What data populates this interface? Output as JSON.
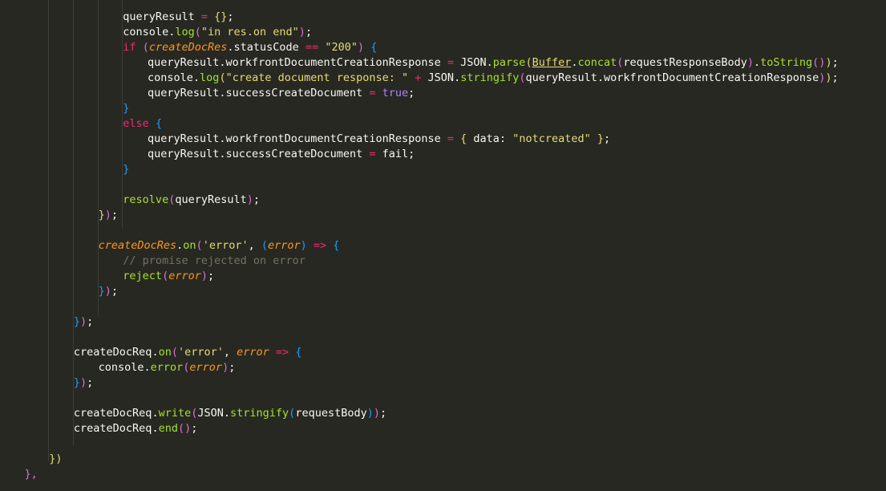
{
  "editor": {
    "theme_colors": {
      "background": "#272822",
      "text": "#f8f8f2",
      "keyword": "#f92672",
      "string": "#e6db74",
      "function": "#a6e22e",
      "parameter": "#fd971f",
      "constant": "#ae81ff",
      "comment": "#75715e"
    },
    "lines": [
      {
        "indent": 4,
        "tokens": [
          {
            "t": "queryResult",
            "c": "plain"
          },
          {
            "t": " = ",
            "c": "op"
          },
          {
            "t": "{}",
            "c": "bracket"
          },
          {
            "t": ";",
            "c": "punct"
          }
        ]
      },
      {
        "indent": 4,
        "tokens": [
          {
            "t": "console",
            "c": "plain"
          },
          {
            "t": ".",
            "c": "punct"
          },
          {
            "t": "log",
            "c": "func"
          },
          {
            "t": "(",
            "c": "bracket2"
          },
          {
            "t": "\"in res.on end\"",
            "c": "str"
          },
          {
            "t": ")",
            "c": "bracket2"
          },
          {
            "t": ";",
            "c": "punct"
          }
        ]
      },
      {
        "indent": 4,
        "tokens": [
          {
            "t": "if",
            "c": "kw"
          },
          {
            "t": " ",
            "c": "plain"
          },
          {
            "t": "(",
            "c": "bracket2"
          },
          {
            "t": "createDocRes",
            "c": "param"
          },
          {
            "t": ".statusCode ",
            "c": "plain"
          },
          {
            "t": "==",
            "c": "op"
          },
          {
            "t": " ",
            "c": "plain"
          },
          {
            "t": "\"200\"",
            "c": "str"
          },
          {
            "t": ")",
            "c": "bracket2"
          },
          {
            "t": " ",
            "c": "plain"
          },
          {
            "t": "{",
            "c": "bracket3"
          }
        ]
      },
      {
        "indent": 5,
        "tokens": [
          {
            "t": "queryResult.workfrontDocumentCreationResponse",
            "c": "plain"
          },
          {
            "t": " = ",
            "c": "op"
          },
          {
            "t": "JSON",
            "c": "plain"
          },
          {
            "t": ".",
            "c": "punct"
          },
          {
            "t": "parse",
            "c": "func"
          },
          {
            "t": "(",
            "c": "bracket"
          },
          {
            "t": "Buffer",
            "c": "type"
          },
          {
            "t": ".",
            "c": "punct"
          },
          {
            "t": "concat",
            "c": "func"
          },
          {
            "t": "(",
            "c": "bracket2"
          },
          {
            "t": "requestResponseBody",
            "c": "plain"
          },
          {
            "t": ")",
            "c": "bracket2"
          },
          {
            "t": ".",
            "c": "punct"
          },
          {
            "t": "toString",
            "c": "func"
          },
          {
            "t": "()",
            "c": "bracket2"
          },
          {
            "t": ")",
            "c": "bracket"
          },
          {
            "t": ";",
            "c": "punct"
          }
        ]
      },
      {
        "indent": 5,
        "tokens": [
          {
            "t": "console",
            "c": "plain"
          },
          {
            "t": ".",
            "c": "punct"
          },
          {
            "t": "log",
            "c": "func"
          },
          {
            "t": "(",
            "c": "bracket"
          },
          {
            "t": "\"create document response: \"",
            "c": "str"
          },
          {
            "t": " + ",
            "c": "op"
          },
          {
            "t": "JSON",
            "c": "plain"
          },
          {
            "t": ".",
            "c": "punct"
          },
          {
            "t": "stringify",
            "c": "func"
          },
          {
            "t": "(",
            "c": "bracket2"
          },
          {
            "t": "queryResult.workfrontDocumentCreationResponse",
            "c": "plain"
          },
          {
            "t": ")",
            "c": "bracket2"
          },
          {
            "t": ")",
            "c": "bracket"
          },
          {
            "t": ";",
            "c": "punct"
          }
        ]
      },
      {
        "indent": 5,
        "tokens": [
          {
            "t": "queryResult.successCreateDocument",
            "c": "plain"
          },
          {
            "t": " = ",
            "c": "op"
          },
          {
            "t": "true",
            "c": "const"
          },
          {
            "t": ";",
            "c": "punct"
          }
        ]
      },
      {
        "indent": 4,
        "tokens": [
          {
            "t": "}",
            "c": "bracket3"
          }
        ]
      },
      {
        "indent": 4,
        "tokens": [
          {
            "t": "else",
            "c": "kw"
          },
          {
            "t": " ",
            "c": "plain"
          },
          {
            "t": "{",
            "c": "bracket3"
          }
        ]
      },
      {
        "indent": 5,
        "tokens": [
          {
            "t": "queryResult.workfrontDocumentCreationResponse",
            "c": "plain"
          },
          {
            "t": " = ",
            "c": "op"
          },
          {
            "t": "{",
            "c": "bracket"
          },
          {
            "t": " data: ",
            "c": "plain"
          },
          {
            "t": "\"notcreated\"",
            "c": "str"
          },
          {
            "t": " ",
            "c": "plain"
          },
          {
            "t": "}",
            "c": "bracket"
          },
          {
            "t": ";",
            "c": "punct"
          }
        ]
      },
      {
        "indent": 5,
        "tokens": [
          {
            "t": "queryResult.successCreateDocument",
            "c": "plain"
          },
          {
            "t": " = ",
            "c": "op"
          },
          {
            "t": "fail",
            "c": "plain"
          },
          {
            "t": ";",
            "c": "punct"
          }
        ]
      },
      {
        "indent": 4,
        "tokens": [
          {
            "t": "}",
            "c": "bracket3"
          }
        ]
      },
      {
        "indent": 0,
        "tokens": []
      },
      {
        "indent": 4,
        "tokens": [
          {
            "t": "resolve",
            "c": "func"
          },
          {
            "t": "(",
            "c": "bracket2"
          },
          {
            "t": "queryResult",
            "c": "plain"
          },
          {
            "t": ")",
            "c": "bracket2"
          },
          {
            "t": ";",
            "c": "punct"
          }
        ]
      },
      {
        "indent": 3,
        "tokens": [
          {
            "t": "}",
            "c": "bracket"
          },
          {
            "t": ")",
            "c": "bracket2"
          },
          {
            "t": ";",
            "c": "punct"
          }
        ]
      },
      {
        "indent": 0,
        "tokens": []
      },
      {
        "indent": 3,
        "tokens": [
          {
            "t": "createDocRes",
            "c": "param"
          },
          {
            "t": ".",
            "c": "punct"
          },
          {
            "t": "on",
            "c": "func"
          },
          {
            "t": "(",
            "c": "bracket2"
          },
          {
            "t": "'error'",
            "c": "str"
          },
          {
            "t": ", ",
            "c": "plain"
          },
          {
            "t": "(",
            "c": "bracket3"
          },
          {
            "t": "error",
            "c": "param"
          },
          {
            "t": ")",
            "c": "bracket3"
          },
          {
            "t": " => ",
            "c": "op"
          },
          {
            "t": "{",
            "c": "bracket3"
          }
        ]
      },
      {
        "indent": 4,
        "tokens": [
          {
            "t": "// promise rejected on error",
            "c": "comment"
          }
        ]
      },
      {
        "indent": 4,
        "tokens": [
          {
            "t": "reject",
            "c": "func"
          },
          {
            "t": "(",
            "c": "bracket2"
          },
          {
            "t": "error",
            "c": "param"
          },
          {
            "t": ")",
            "c": "bracket2"
          },
          {
            "t": ";",
            "c": "punct"
          }
        ]
      },
      {
        "indent": 3,
        "tokens": [
          {
            "t": "}",
            "c": "bracket3"
          },
          {
            "t": ")",
            "c": "bracket2"
          },
          {
            "t": ";",
            "c": "punct"
          }
        ]
      },
      {
        "indent": 0,
        "tokens": []
      },
      {
        "indent": 2,
        "tokens": [
          {
            "t": "}",
            "c": "bracket3"
          },
          {
            "t": ")",
            "c": "bracket2"
          },
          {
            "t": ";",
            "c": "punct"
          }
        ]
      },
      {
        "indent": 0,
        "tokens": []
      },
      {
        "indent": 2,
        "tokens": [
          {
            "t": "createDocReq",
            "c": "plain"
          },
          {
            "t": ".",
            "c": "punct"
          },
          {
            "t": "on",
            "c": "func"
          },
          {
            "t": "(",
            "c": "bracket2"
          },
          {
            "t": "'error'",
            "c": "str"
          },
          {
            "t": ", ",
            "c": "plain"
          },
          {
            "t": "error",
            "c": "param"
          },
          {
            "t": " => ",
            "c": "op"
          },
          {
            "t": "{",
            "c": "bracket3"
          }
        ]
      },
      {
        "indent": 3,
        "tokens": [
          {
            "t": "console",
            "c": "plain"
          },
          {
            "t": ".",
            "c": "punct"
          },
          {
            "t": "error",
            "c": "func"
          },
          {
            "t": "(",
            "c": "bracket2"
          },
          {
            "t": "error",
            "c": "param"
          },
          {
            "t": ")",
            "c": "bracket2"
          },
          {
            "t": ";",
            "c": "punct"
          }
        ]
      },
      {
        "indent": 2,
        "tokens": [
          {
            "t": "}",
            "c": "bracket3"
          },
          {
            "t": ")",
            "c": "bracket2"
          },
          {
            "t": ";",
            "c": "punct"
          }
        ]
      },
      {
        "indent": 0,
        "tokens": []
      },
      {
        "indent": 2,
        "tokens": [
          {
            "t": "createDocReq",
            "c": "plain"
          },
          {
            "t": ".",
            "c": "punct"
          },
          {
            "t": "write",
            "c": "func"
          },
          {
            "t": "(",
            "c": "bracket2"
          },
          {
            "t": "JSON",
            "c": "plain"
          },
          {
            "t": ".",
            "c": "punct"
          },
          {
            "t": "stringify",
            "c": "func"
          },
          {
            "t": "(",
            "c": "bracket3"
          },
          {
            "t": "requestBody",
            "c": "plain"
          },
          {
            "t": ")",
            "c": "bracket3"
          },
          {
            "t": ")",
            "c": "bracket2"
          },
          {
            "t": ";",
            "c": "punct"
          }
        ]
      },
      {
        "indent": 2,
        "tokens": [
          {
            "t": "createDocReq",
            "c": "plain"
          },
          {
            "t": ".",
            "c": "punct"
          },
          {
            "t": "end",
            "c": "func"
          },
          {
            "t": "()",
            "c": "bracket2"
          },
          {
            "t": ";",
            "c": "punct"
          }
        ]
      },
      {
        "indent": 0,
        "tokens": []
      },
      {
        "indent": 1,
        "tokens": [
          {
            "t": "})",
            "c": "bracket"
          }
        ]
      },
      {
        "indent": 0,
        "tokens": [
          {
            "t": "},",
            "c": "bracket2"
          }
        ]
      }
    ]
  }
}
